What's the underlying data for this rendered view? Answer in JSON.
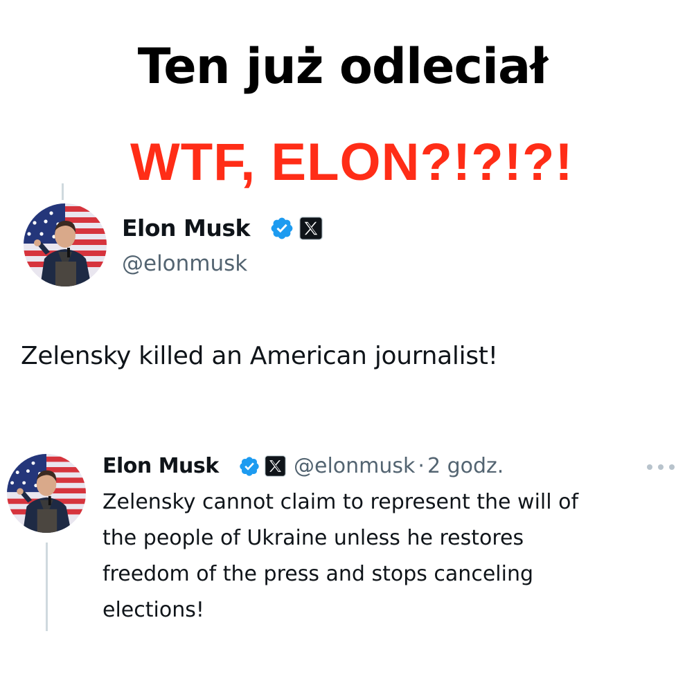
{
  "headline": "Ten już odleciał",
  "subheadline": "WTF, ELON?!?!?!",
  "colors": {
    "headline": "#000000",
    "subheadline": "#ff2d17",
    "verified": "#1d9bf0",
    "secondary_text": "#536471",
    "thread_line": "#cfd9de"
  },
  "main_tweet": {
    "author_name": "Elon Musk",
    "author_handle": "@elonmusk",
    "verified_icon": "verified-badge-icon",
    "affiliation_icon": "x-logo-icon",
    "text": "Zelensky killed an American journalist!"
  },
  "quoted_tweet": {
    "author_name": "Elon Musk",
    "author_handle": "@elonmusk",
    "separator": "·",
    "timestamp": "2 godz.",
    "verified_icon": "verified-badge-icon",
    "affiliation_icon": "x-logo-icon",
    "more_icon": "more-horizontal-icon",
    "text_lines": [
      "Zelensky cannot claim to represent the will of",
      "the people of Ukraine unless he restores",
      "freedom of the press and stops canceling",
      "elections!"
    ]
  }
}
